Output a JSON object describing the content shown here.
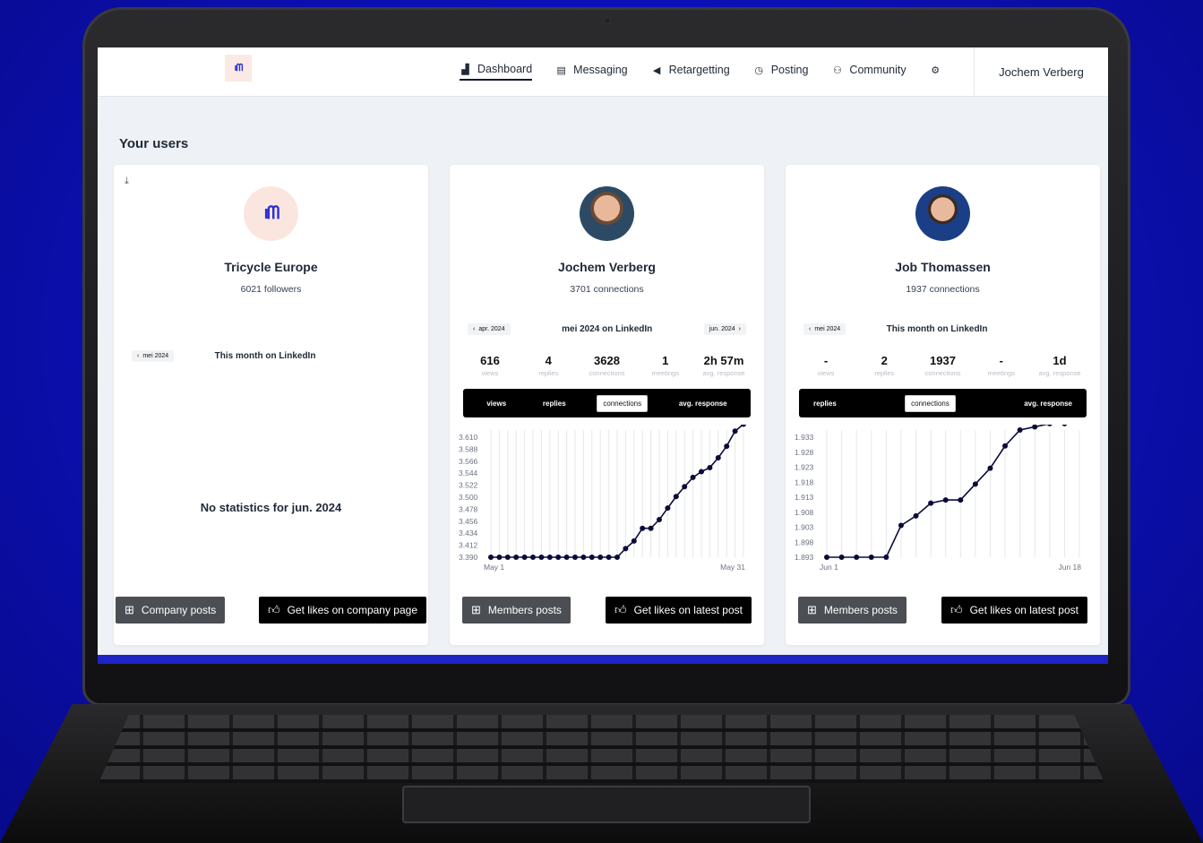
{
  "header": {
    "logo_text": "ıᗰ",
    "nav": [
      {
        "label": "Dashboard",
        "icon": "chart-icon",
        "glyph": "▟"
      },
      {
        "label": "Messaging",
        "icon": "message-icon",
        "glyph": "▤"
      },
      {
        "label": "Retargetting",
        "icon": "megaphone-icon",
        "glyph": "◀"
      },
      {
        "label": "Posting",
        "icon": "clock-icon",
        "glyph": "◷"
      },
      {
        "label": "Community",
        "icon": "people-icon",
        "glyph": "⚇"
      }
    ],
    "settings_glyph": "⚙",
    "user": "Jochem Verberg"
  },
  "section_title": "Your users",
  "cards": [
    {
      "name": "Tricycle Europe",
      "sub": "6021 followers",
      "download_glyph": "⤓",
      "prev_month": "mei 2024",
      "month_label": "This month on LinkedIn",
      "no_stats": "No statistics for jun. 2024",
      "btn_left": "Company posts",
      "btn_right": "Get likes on company page"
    },
    {
      "name": "Jochem Verberg",
      "sub": "3701 connections",
      "prev_month": "apr. 2024",
      "month_label": "mei 2024 on LinkedIn",
      "next_month": "jun. 2024",
      "stats": [
        {
          "value": "616",
          "label": "views"
        },
        {
          "value": "4",
          "label": "replies"
        },
        {
          "value": "3628",
          "label": "connections"
        },
        {
          "value": "1",
          "label": "meetings"
        },
        {
          "value": "2h 57m",
          "label": "avg. response"
        }
      ],
      "tabs": [
        "views",
        "replies",
        "connections",
        "avg. response"
      ],
      "active_tab": "connections",
      "btn_left": "Members posts",
      "btn_right": "Get likes on latest post"
    },
    {
      "name": "Job Thomassen",
      "sub": "1937 connections",
      "prev_month": "mei 2024",
      "month_label": "This month on LinkedIn",
      "stats": [
        {
          "value": "-",
          "label": "views"
        },
        {
          "value": "2",
          "label": "replies"
        },
        {
          "value": "1937",
          "label": "connections"
        },
        {
          "value": "-",
          "label": "meetings"
        },
        {
          "value": "1d",
          "label": "avg. response"
        }
      ],
      "tabs": [
        "replies",
        "connections",
        "avg. response"
      ],
      "active_tab": "connections",
      "btn_left": "Members posts",
      "btn_right": "Get likes on latest post"
    }
  ],
  "chart_data": [
    {
      "type": "line",
      "x_start_label": "May 1",
      "x_end_label": "May 31",
      "yticks": [
        "3.610",
        "3.588",
        "3.566",
        "3.544",
        "3.522",
        "3.500",
        "3.478",
        "3.456",
        "3.434",
        "3.412",
        "3.390"
      ],
      "ylim": [
        3390,
        3610
      ],
      "values": [
        3390,
        3390,
        3390,
        3390,
        3390,
        3390,
        3390,
        3390,
        3390,
        3390,
        3390,
        3390,
        3390,
        3390,
        3390,
        3390,
        3405,
        3418,
        3440,
        3440,
        3455,
        3475,
        3495,
        3512,
        3528,
        3538,
        3545,
        3562,
        3582,
        3608,
        3620
      ],
      "color": "#0b0b3b"
    },
    {
      "type": "line",
      "x_start_label": "Jun 1",
      "x_end_label": "Jun 18",
      "yticks": [
        "1.933",
        "1.928",
        "1.923",
        "1.918",
        "1.913",
        "1.908",
        "1.903",
        "1.898",
        "1.893"
      ],
      "ylim": [
        1893,
        1933
      ],
      "values": [
        1893,
        1893,
        1893,
        1893,
        1893,
        1903,
        1906,
        1910,
        1911,
        1911,
        1916,
        1921,
        1928,
        1933,
        1934,
        1935,
        1935,
        1937
      ],
      "color": "#0b0b3b"
    }
  ],
  "colors": {
    "accent": "#2b2fd6",
    "background": "#0d10b8",
    "dark": "#000000"
  }
}
